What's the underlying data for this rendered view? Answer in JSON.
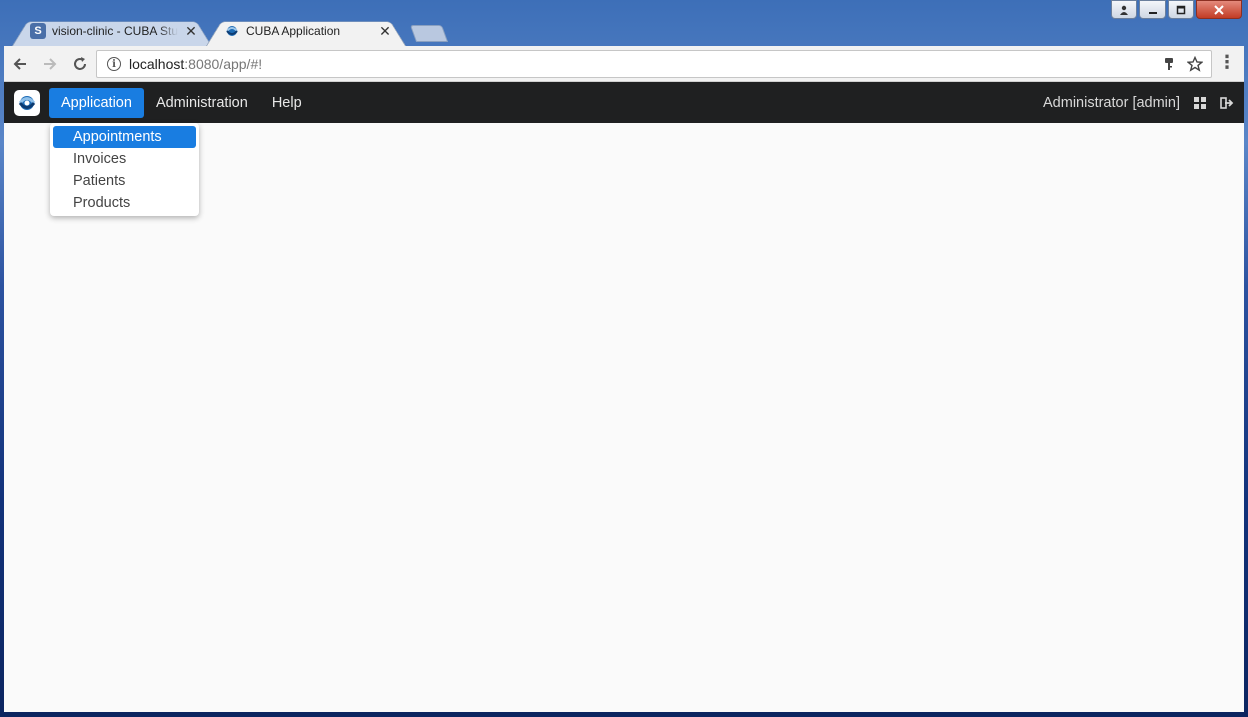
{
  "window": {
    "controls": [
      "user",
      "minimize",
      "maximize",
      "close"
    ]
  },
  "tabs": [
    {
      "title": "vision-clinic - CUBA Studio",
      "active": false,
      "icon": "s-favicon"
    },
    {
      "title": "CUBA Application",
      "active": true,
      "icon": "cuba-favicon"
    }
  ],
  "toolbar": {
    "url_host": "localhost",
    "url_rest": ":8080/app/#!"
  },
  "app": {
    "menu": [
      {
        "label": "Application",
        "selected": true
      },
      {
        "label": "Administration",
        "selected": false
      },
      {
        "label": "Help",
        "selected": false
      }
    ],
    "user_label": "Administrator [admin]",
    "dropdown": [
      {
        "label": "Appointments",
        "highlighted": true
      },
      {
        "label": "Invoices",
        "highlighted": false
      },
      {
        "label": "Patients",
        "highlighted": false
      },
      {
        "label": "Products",
        "highlighted": false
      }
    ]
  },
  "colors": {
    "accent": "#197de1",
    "appbar": "#1f2021",
    "content_bg": "#fafafa"
  }
}
